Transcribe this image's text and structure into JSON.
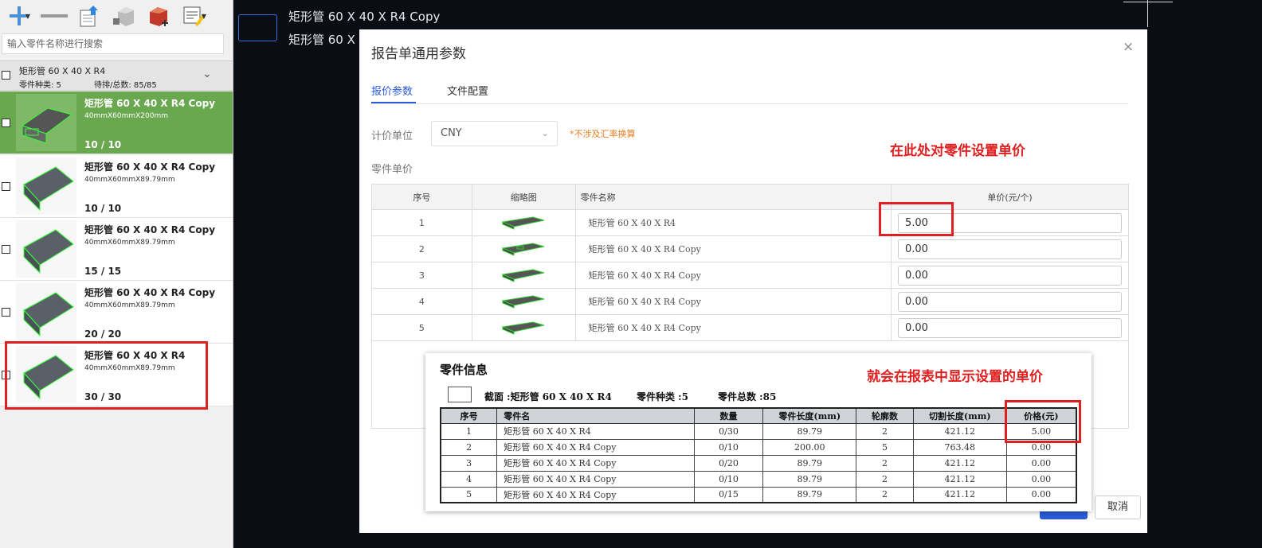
{
  "sidebar": {
    "search_placeholder": "输入零件名称进行搜索",
    "group": {
      "title": "矩形管 60 X 40 X R4",
      "kinds": "零件种类:  5",
      "pending": "待排/总数: 85/85"
    },
    "parts": [
      {
        "name": "矩形管 60 X 40 X R4 Copy",
        "size": "40mmX60mmX200mm",
        "count": "10 / 10"
      },
      {
        "name": "矩形管 60 X 40 X R4 Copy",
        "size": "40mmX60mmX89.79mm",
        "count": "10 / 10"
      },
      {
        "name": "矩形管 60 X 40 X R4 Copy",
        "size": "40mmX60mmX89.79mm",
        "count": "15 / 15"
      },
      {
        "name": "矩形管 60 X 40 X R4 Copy",
        "size": "40mmX60mmX89.79mm",
        "count": "20 / 20"
      },
      {
        "name": "矩形管 60 X 40 X R4",
        "size": "40mmX60mmX89.79mm",
        "count": "30 / 30"
      }
    ]
  },
  "canvas": {
    "title1": "矩形管 60 X 40 X R4 Copy",
    "title2": "矩形管 60 X"
  },
  "dialog": {
    "title": "报告单通用参数",
    "close": "×",
    "tabs": [
      "报价参数",
      "文件配置"
    ],
    "unit_label": "计价单位",
    "unit_value": "CNY",
    "unit_note": "*不涉及汇率换算",
    "price_label": "零件单价",
    "columns": [
      "序号",
      "缩略图",
      "零件名称",
      "单价(元/个)"
    ],
    "rows": [
      {
        "no": "1",
        "name": "矩形管 60 X 40 X R4",
        "price": "5.00"
      },
      {
        "no": "2",
        "name": "矩形管 60 X 40 X R4 Copy",
        "price": "0.00"
      },
      {
        "no": "3",
        "name": "矩形管 60 X 40 X R4 Copy",
        "price": "0.00"
      },
      {
        "no": "4",
        "name": "矩形管 60 X 40 X R4 Copy",
        "price": "0.00"
      },
      {
        "no": "5",
        "name": "矩形管 60 X 40 X R4 Copy",
        "price": "0.00"
      }
    ],
    "cancel": "取消"
  },
  "report": {
    "title": "零件信息",
    "section": "截面 :矩形管 60 X 40 X R4",
    "kinds": "零件种类 :5",
    "total": "零件总数 :85",
    "columns": [
      "序号",
      "零件名",
      "数量",
      "零件长度(mm)",
      "轮廓数",
      "切割长度(mm)",
      "价格(元)"
    ],
    "rows": [
      [
        "1",
        "矩形管 60 X 40 X R4",
        "0/30",
        "89.79",
        "2",
        "421.12",
        "5.00"
      ],
      [
        "2",
        "矩形管 60 X 40 X R4 Copy",
        "0/10",
        "200.00",
        "5",
        "763.48",
        "0.00"
      ],
      [
        "3",
        "矩形管 60 X 40 X R4 Copy",
        "0/20",
        "89.79",
        "2",
        "421.12",
        "0.00"
      ],
      [
        "4",
        "矩形管 60 X 40 X R4 Copy",
        "0/10",
        "89.79",
        "2",
        "421.12",
        "0.00"
      ],
      [
        "5",
        "矩形管 60 X 40 X R4 Copy",
        "0/15",
        "89.79",
        "2",
        "421.12",
        "0.00"
      ]
    ]
  },
  "annotations": {
    "set_price": "在此处对零件设置单价",
    "show_price": "就会在报表中显示设置的单价"
  },
  "colors": {
    "accent": "#2a5bd7",
    "active_part": "#6aa84f",
    "annotation": "#e02020",
    "note": "#e67e22"
  }
}
